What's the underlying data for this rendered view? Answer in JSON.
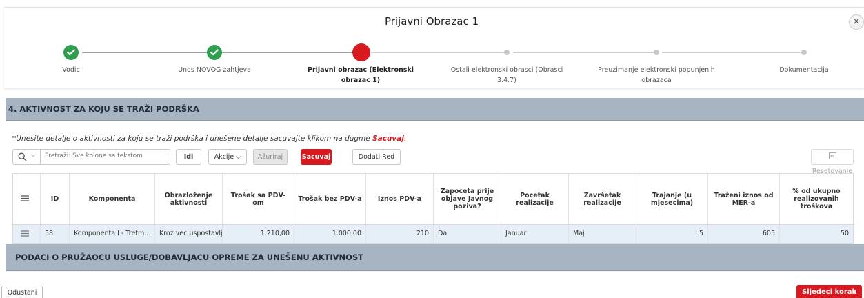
{
  "dialog": {
    "title": "Prijavni Obrazac 1",
    "close_symbol": "×"
  },
  "steps": [
    {
      "label": "Vodic",
      "status": "done"
    },
    {
      "label": "Unos NOVOG zahtjeva",
      "status": "done"
    },
    {
      "label": "Prijavni obrazac (Elektronski obrazac 1)",
      "status": "current"
    },
    {
      "label": "Ostali elektronski obrasci (Obrasci 3.4.7)",
      "status": "future"
    },
    {
      "label": "Preuzimanje elektronski popunjenih obrazaca",
      "status": "future"
    },
    {
      "label": "Dokumentacija",
      "status": "future"
    }
  ],
  "section": {
    "title": "4. AKTIVNOST ZA KOJU SE TRAŽI PODRŠKA",
    "instruction_prefix": "*Unesite detalje o aktivnosti za koju se traži podrška i unešene detalje sacuvajte klikom na dugme ",
    "instruction_emphasis": "Sacuvaj",
    "instruction_suffix": "."
  },
  "toolbar": {
    "search_placeholder": "Pretraži: Sve kolone sa tekstom",
    "go_label": "Idi",
    "actions_label": "Akcije",
    "update_label": "Ažuriraj",
    "save_label": "Sacuvaj",
    "add_row_label": "Dodati Red",
    "reset_label": "Resetovanje"
  },
  "grid": {
    "columns": [
      "ID",
      "Komponenta",
      "Obrazloženje aktivnosti",
      "Trošak sa PDV-om",
      "Trošak bez PDV-a",
      "Iznos PDV-a",
      "Zapoceta prije objave Javnog poziva?",
      "Pocetak realizacije",
      "Završetak realizacije",
      "Trajanje (u mjesecima)",
      "Traženi iznos od MER-a",
      "% od ukupno realizovanih troškova"
    ],
    "rows": [
      {
        "id": "58",
        "komponenta": "Komponenta I - Tretm...",
        "obrazlozenje": "Kroz vec uspostavlj...",
        "trosak_pdv": "1.210,00",
        "trosak_bez_pdv": "1.000,00",
        "iznos_pdv": "210",
        "zapoceta": "Da",
        "pocetak": "Januar",
        "zavrsetak": "Maj",
        "trajanje": "5",
        "trazeni_iznos": "605",
        "procenat": "50"
      }
    ]
  },
  "section2": {
    "title": "PODACI O PRUŽAOCU USLUGE/DOBAVLJACU OPREME ZA UNEŠENU AKTIVNOST"
  },
  "footer": {
    "cancel_label": "Odustani",
    "next_label": "Sljedeci korak",
    "next_arrow": "›"
  },
  "colors": {
    "accent_red": "#d71920",
    "done_green": "#2e9e4f",
    "region_header": "#a7b4c1",
    "selected_row": "#e6eff8"
  }
}
